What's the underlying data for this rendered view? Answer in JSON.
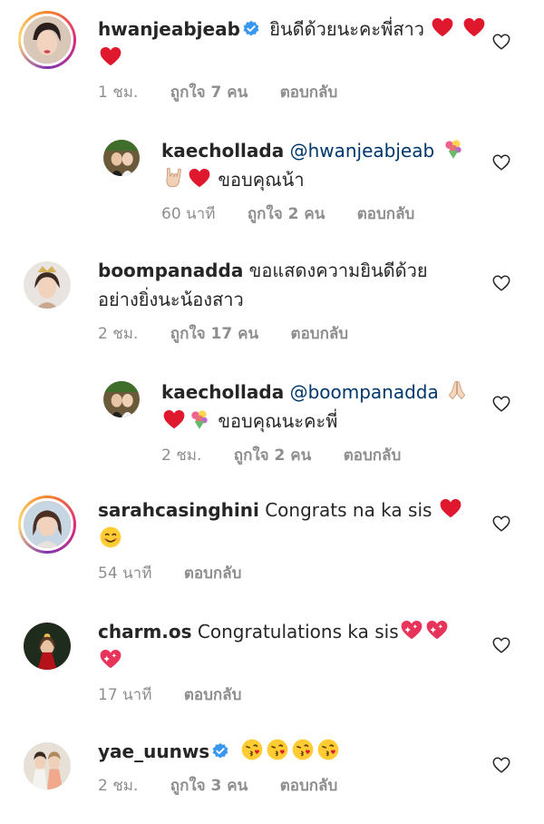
{
  "comments": [
    {
      "username": "hwanjeabjeab",
      "verified": true,
      "text": "ยินดีด้วยนะคะพี่สาว",
      "time": "1 ชม.",
      "likes": "ถูกใจ 7 คน",
      "reply": "ตอบกลับ"
    },
    {
      "username": "kaechollada",
      "mention": "@hwanjeabjeab",
      "text": "ขอบคุณน้า",
      "time": "60 นาที",
      "likes": "ถูกใจ 2 คน",
      "reply": "ตอบกลับ"
    },
    {
      "username": "boompanadda",
      "text": "ขอแสดงความยินดีด้วยอย่างยิ่งนะน้องสาว",
      "text_line1": "ขอแสดงความยินดีด้วย",
      "text_line2": "อย่างยิ่งนะน้องสาว",
      "time": "2 ชม.",
      "likes": "ถูกใจ 17 คน",
      "reply": "ตอบกลับ"
    },
    {
      "username": "kaechollada",
      "mention": "@boompanadda",
      "text": "ขอบคุณนะคะพี่",
      "time": "2 ชม.",
      "likes": "ถูกใจ 2 คน",
      "reply": "ตอบกลับ"
    },
    {
      "username": "sarahcasinghini",
      "text": "Congrats na ka sis",
      "time": "54 นาที",
      "reply": "ตอบกลับ"
    },
    {
      "username": "charm.os",
      "text": "Congratulations ka sis",
      "time": "17 นาที",
      "reply": "ตอบกลับ"
    },
    {
      "username": "yae_uunws",
      "verified": true,
      "time": "2 ชม.",
      "likes": "ถูกใจ 3 คน",
      "reply": "ตอบกลับ"
    }
  ],
  "icons": {
    "like": "heart-outline-icon",
    "verified": "verified-badge-icon"
  },
  "colors": {
    "text": "#262626",
    "meta": "#8e8e8e",
    "mention": "#00376b",
    "verified": "#3897f0",
    "heart_emoji": "#e0182d"
  }
}
